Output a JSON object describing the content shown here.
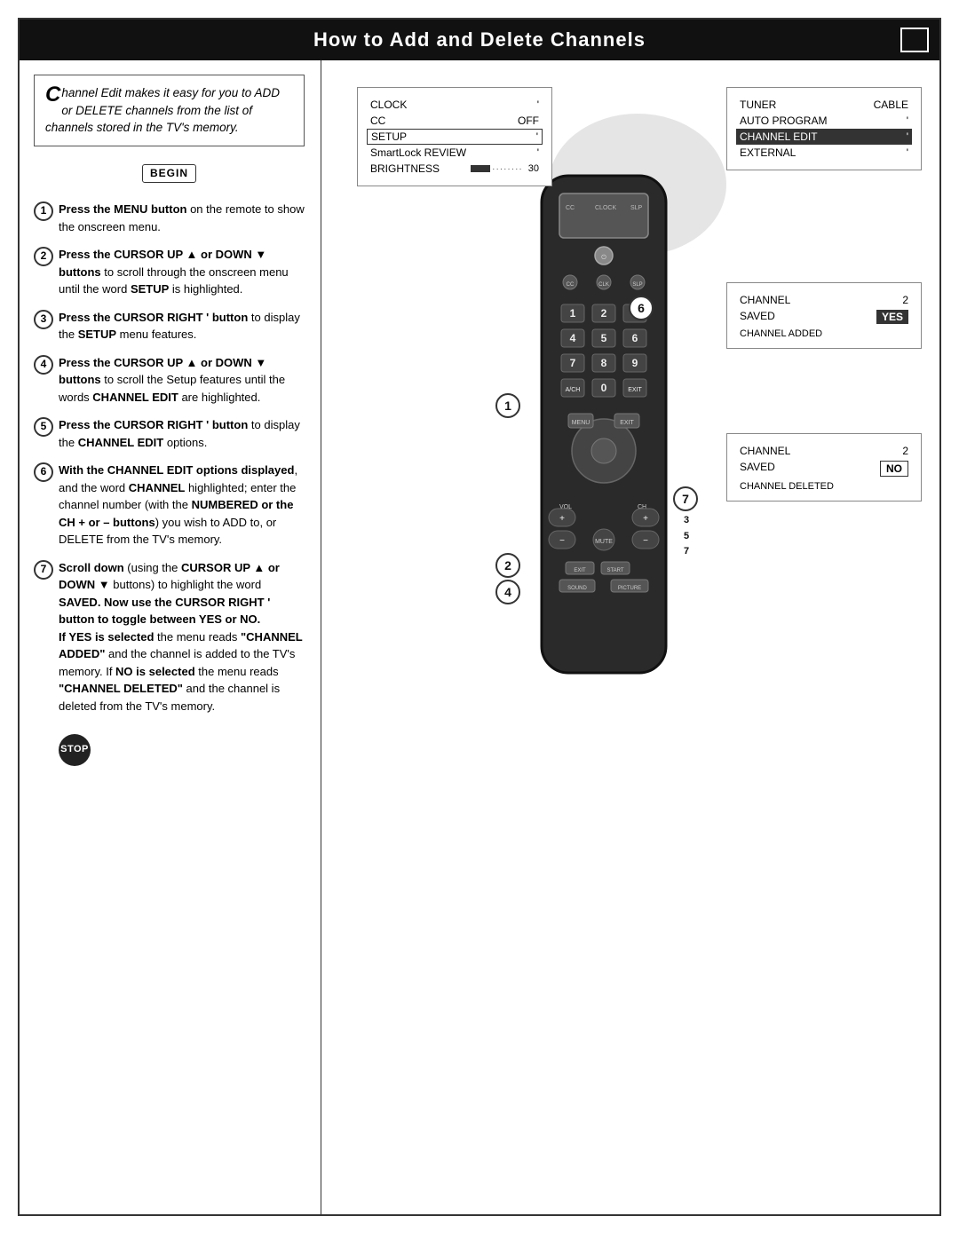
{
  "page": {
    "title": "How to Add and Delete Channels",
    "corner_box": ""
  },
  "intro": {
    "drop_cap": "C",
    "text": "hannel Edit makes it easy for you to ADD or DELETE channels from the list of channels stored in the TV's memory."
  },
  "begin_label": "BEGIN",
  "stop_label": "STOP",
  "steps": [
    {
      "number": "1",
      "text_parts": [
        {
          "bold": true,
          "text": "Press the MENU button"
        },
        {
          "bold": false,
          "text": " on the remote to show the onscreen menu."
        }
      ]
    },
    {
      "number": "2",
      "text_parts": [
        {
          "bold": true,
          "text": "Press the CURSOR UP ▲ or DOWN ▼ buttons"
        },
        {
          "bold": false,
          "text": " to scroll through the onscreen menu until the word "
        },
        {
          "bold": true,
          "text": "SETUP"
        },
        {
          "bold": false,
          "text": " is highlighted."
        }
      ]
    },
    {
      "number": "3",
      "text_parts": [
        {
          "bold": true,
          "text": "Press the CURSOR RIGHT ' button"
        },
        {
          "bold": false,
          "text": " to display the "
        },
        {
          "bold": true,
          "text": "SETUP"
        },
        {
          "bold": false,
          "text": " menu features."
        }
      ]
    },
    {
      "number": "4",
      "text_parts": [
        {
          "bold": true,
          "text": "Press the CURSOR UP ▲ or DOWN ▼ buttons"
        },
        {
          "bold": false,
          "text": " to scroll the Setup features until the words "
        },
        {
          "bold": true,
          "text": "CHANNEL EDIT"
        },
        {
          "bold": false,
          "text": " are highlighted."
        }
      ]
    },
    {
      "number": "5",
      "text_parts": [
        {
          "bold": true,
          "text": "Press the CURSOR RIGHT ' button"
        },
        {
          "bold": false,
          "text": " to display the "
        },
        {
          "bold": true,
          "text": "CHANNEL EDIT"
        },
        {
          "bold": false,
          "text": " options."
        }
      ]
    },
    {
      "number": "6",
      "text_parts": [
        {
          "bold": true,
          "text": "With the CHANNEL EDIT options displayed"
        },
        {
          "bold": false,
          "text": ", and the word "
        },
        {
          "bold": true,
          "text": "CHANNEL"
        },
        {
          "bold": false,
          "text": " highlighted; enter the channel number (with the "
        },
        {
          "bold": true,
          "text": "NUMBERED or the CH + or – buttons"
        },
        {
          "bold": false,
          "text": ") you wish to ADD to, or DELETE from the TV's memory."
        }
      ]
    },
    {
      "number": "7",
      "text_parts": [
        {
          "bold": true,
          "text": "Scroll down"
        },
        {
          "bold": false,
          "text": " (using the "
        },
        {
          "bold": true,
          "text": "CURSOR UP ▲ or DOWN ▼"
        },
        {
          "bold": false,
          "text": " buttons) to highlight the word "
        },
        {
          "bold": true,
          "text": "SAVED."
        },
        {
          "bold": false,
          "text": " Now use the "
        },
        {
          "bold": true,
          "text": "CURSOR RIGHT ' button to toggle between YES or NO."
        },
        {
          "bold": false,
          "text": "\nIf YES is selected"
        },
        {
          "bold": false,
          "text": " the menu reads "
        },
        {
          "bold": true,
          "text": "\"CHANNEL ADDED\""
        },
        {
          "bold": false,
          "text": " and the channel is added to the TV's memory. If "
        },
        {
          "bold": false,
          "text": "NO is selected"
        },
        {
          "bold": false,
          "text": " the menu reads "
        },
        {
          "bold": true,
          "text": "\"CHANNEL DELETED\""
        },
        {
          "bold": false,
          "text": " and the channel is deleted from the TV's memory."
        }
      ]
    }
  ],
  "tv_screen1": {
    "rows": [
      {
        "label": "CLOCK",
        "value": "'"
      },
      {
        "label": "CC",
        "value": "OFF"
      },
      {
        "label": "SETUP",
        "value": "'",
        "selected": true
      },
      {
        "label": "SmartLock REVIEW",
        "value": "'"
      },
      {
        "label": "BRIGHTNESS",
        "bar": true,
        "value": "30"
      }
    ]
  },
  "tv_screen2": {
    "title_left": "TUNER",
    "title_right": "CABLE",
    "rows": [
      {
        "label": "AUTO PROGRAM",
        "value": "'"
      },
      {
        "label": "CHANNEL EDIT",
        "value": "'",
        "highlighted": true
      },
      {
        "label": "EXTERNAL",
        "value": "'"
      }
    ]
  },
  "channel_screen_added": {
    "channel_label": "CHANNEL",
    "channel_value": "2",
    "saved_label": "SAVED",
    "saved_value": "YES",
    "status": "CHANNEL ADDED"
  },
  "channel_screen_deleted": {
    "channel_label": "CHANNEL",
    "channel_value": "2",
    "saved_label": "SAVED",
    "saved_value": "NO",
    "status": "CHANNEL DELETED"
  },
  "remote": {
    "buttons": [
      "1",
      "2",
      "3",
      "4",
      "5",
      "6",
      "7",
      "8",
      "9",
      "A/CH",
      "0",
      "EXIT"
    ],
    "labels_top": [
      "CC",
      "CLOCK",
      "SLP"
    ]
  },
  "overlay_numbers": [
    {
      "n": "1",
      "desc": "step1-overlay"
    },
    {
      "n": "2",
      "desc": "step2-overlay"
    },
    {
      "n": "3",
      "desc": "step3-overlay"
    },
    {
      "n": "4",
      "desc": "step4-overlay"
    },
    {
      "n": "5",
      "desc": "step5-overlay"
    },
    {
      "n": "6",
      "desc": "step6-overlay"
    },
    {
      "n": "7",
      "desc": "step7-overlay"
    }
  ]
}
